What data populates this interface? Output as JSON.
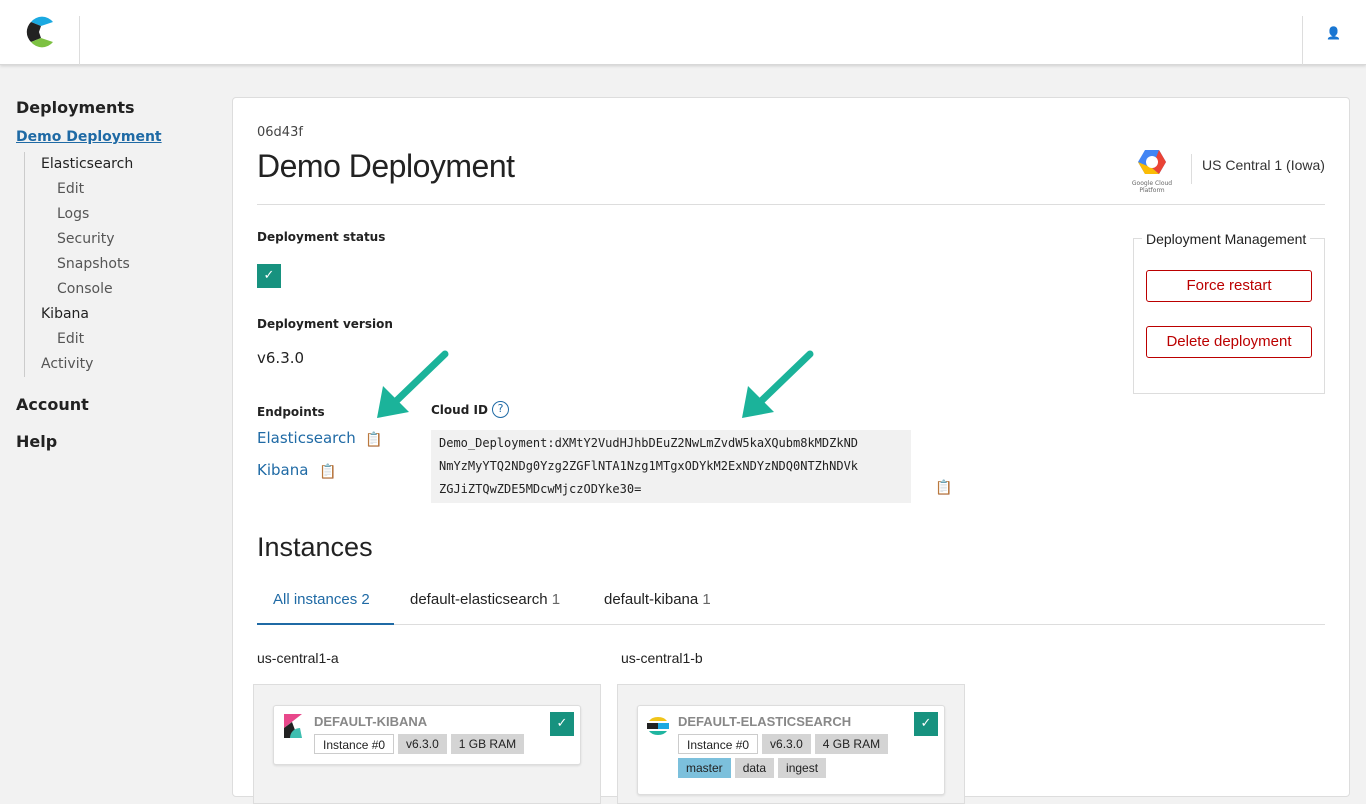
{
  "header": {
    "user_icon": "user-icon"
  },
  "sidebar": {
    "title": "Deployments",
    "current": "Demo Deployment",
    "tree": [
      {
        "label": "Elasticsearch",
        "level": 1
      },
      {
        "label": "Edit",
        "level": 2
      },
      {
        "label": "Logs",
        "level": 2
      },
      {
        "label": "Security",
        "level": 2
      },
      {
        "label": "Snapshots",
        "level": 2
      },
      {
        "label": "Console",
        "level": 2
      },
      {
        "label": "Kibana",
        "level": 1
      },
      {
        "label": "Edit",
        "level": 2
      },
      {
        "label": "Activity",
        "level": 1
      }
    ],
    "account": "Account",
    "help": "Help"
  },
  "deployment": {
    "id": "06d43f",
    "title": "Demo Deployment",
    "provider": "Google Cloud Platform",
    "region": "US Central 1 (Iowa)",
    "status_label": "Deployment status",
    "version_label": "Deployment version",
    "version": "v6.3.0",
    "endpoints_label": "Endpoints",
    "endpoints": [
      "Elasticsearch",
      "Kibana"
    ],
    "cloud_id_label": "Cloud ID",
    "cloud_id_lines": [
      "Demo_Deployment:dXMtY2VudHJhbDEuZ2NwLmZvdW5kaXQubm8kMDZkND",
      "NmYzMyYTQ2NDg0Yzg2ZGFlNTA1Nzg1MTgxODYkM2ExNDYzNDQ0NTZhNDVk",
      "ZGJiZTQwZDE5MDcwMjczODYke30="
    ]
  },
  "management": {
    "title": "Deployment Management",
    "force_restart": "Force restart",
    "delete": "Delete deployment"
  },
  "instances": {
    "title": "Instances",
    "tabs": [
      {
        "label": "All instances",
        "count": "2"
      },
      {
        "label": "default-elasticsearch",
        "count": "1"
      },
      {
        "label": "default-kibana",
        "count": "1"
      }
    ],
    "zones": [
      {
        "name": "us-central1-a",
        "instance": {
          "name": "DEFAULT-KIBANA",
          "tags": [
            "Instance #0",
            "v6.3.0",
            "1 GB RAM"
          ]
        }
      },
      {
        "name": "us-central1-b",
        "instance": {
          "name": "DEFAULT-ELASTICSEARCH",
          "tags": [
            "Instance #0",
            "v6.3.0",
            "4 GB RAM"
          ],
          "roles": [
            "master",
            "data",
            "ingest"
          ]
        }
      }
    ]
  },
  "colors": {
    "accent": "#1f6aa5",
    "danger": "#b00000",
    "healthy": "#17927f",
    "arrow": "#1bb39a"
  }
}
